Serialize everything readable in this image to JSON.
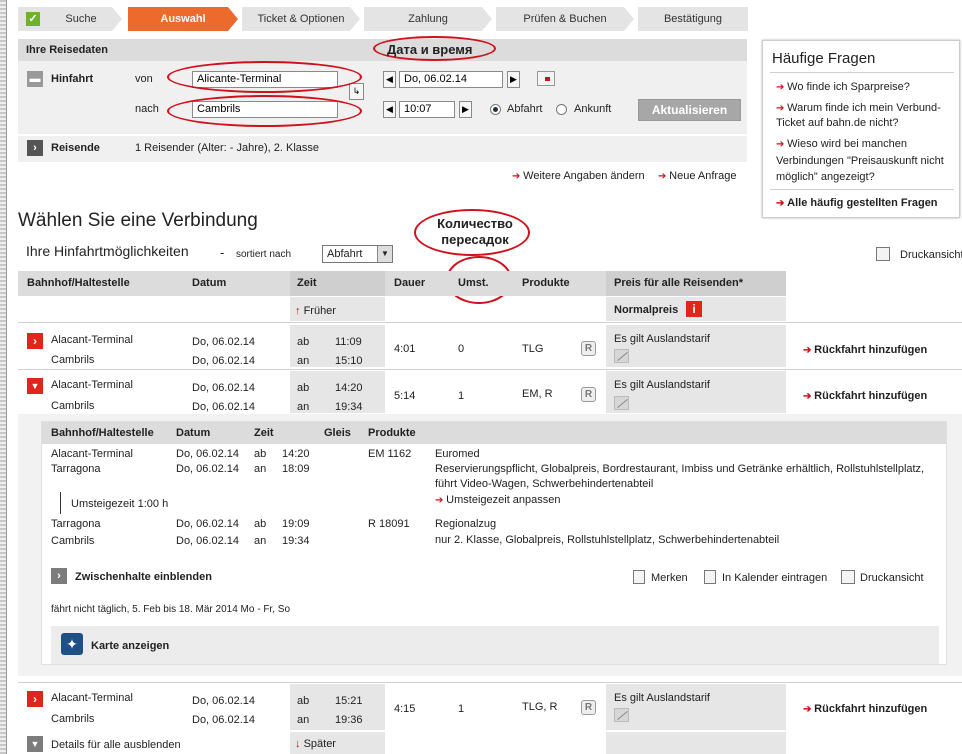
{
  "steps": [
    {
      "label": "Suche"
    },
    {
      "label": "Auswahl"
    },
    {
      "label": "Ticket & Optionen"
    },
    {
      "label": "Zahlung"
    },
    {
      "label": "Prüfen & Buchen"
    },
    {
      "label": "Bestätigung"
    }
  ],
  "reisedaten": {
    "title": "Ihre Reisedaten",
    "hinfahrt": "Hinfahrt",
    "von_label": "von",
    "von_value": "Alicante-Terminal",
    "nach_label": "nach",
    "nach_value": "Cambrils",
    "date_value": "Do, 06.02.14",
    "time_value": "10:07",
    "abfahrt": "Abfahrt",
    "ankunft": "Ankunft",
    "update_button": "Aktualisieren",
    "reisende_label": "Reisende",
    "reisende_value": "1 Reisender (Alter: - Jahre), 2. Klasse",
    "weitere": "Weitere Angaben ändern",
    "neue": "Neue Anfrage"
  },
  "annotations": {
    "date_time": "Дата и время",
    "transfers": "Количество пересадок"
  },
  "faq": {
    "title": "Häufige Fragen",
    "items": [
      "Wo finde ich Sparpreise?",
      "Warum finde ich mein Verbund-Ticket auf bahn.de nicht?",
      "Wieso wird bei manchen Verbindungen \"Preisauskunft nicht möglich\" angezeigt?"
    ],
    "all": "Alle häufig gestellten Fragen"
  },
  "results": {
    "title": "Wählen Sie eine Verbindung",
    "subtitle": "Ihre Hinfahrtmöglichkeiten",
    "dash": "-",
    "sorted": "sortiert nach",
    "sort_value": "Abfahrt",
    "print": "Druckansicht",
    "columns": [
      "Bahnhof/Haltestelle",
      "Datum",
      "Zeit",
      "Dauer",
      "Umst.",
      "Produkte",
      "Preis für alle Reisenden*"
    ],
    "earlier": "Früher",
    "later": "Später",
    "normalpreis": "Normalpreis",
    "rows": [
      {
        "from": "Alacant-Terminal",
        "to": "Cambrils",
        "date1": "Do, 06.02.14",
        "date2": "Do, 06.02.14",
        "ab": "ab",
        "an": "an",
        "t1": "11:09",
        "t2": "15:10",
        "dur": "4:01",
        "umst": "0",
        "prod": "TLG",
        "price": "Es gilt Auslandstarif",
        "ret": "Rückfahrt hinzufügen"
      },
      {
        "from": "Alacant-Terminal",
        "to": "Cambrils",
        "date1": "Do, 06.02.14",
        "date2": "Do, 06.02.14",
        "ab": "ab",
        "an": "an",
        "t1": "14:20",
        "t2": "19:34",
        "dur": "5:14",
        "umst": "1",
        "prod": "EM, R",
        "price": "Es gilt Auslandstarif",
        "ret": "Rückfahrt hinzufügen"
      },
      {
        "from": "Alacant-Terminal",
        "to": "Cambrils",
        "date1": "Do, 06.02.14",
        "date2": "Do, 06.02.14",
        "ab": "ab",
        "an": "an",
        "t1": "15:21",
        "t2": "19:36",
        "dur": "4:15",
        "umst": "1",
        "prod": "TLG, R",
        "price": "Es gilt Auslandstarif",
        "ret": "Rückfahrt hinzufügen"
      }
    ],
    "hide_details": "Details für alle ausblenden"
  },
  "details": {
    "columns": [
      "Bahnhof/Haltestelle",
      "Datum",
      "Zeit",
      "Gleis",
      "Produkte"
    ],
    "leg1": {
      "from": "Alacant-Terminal",
      "to": "Tarragona",
      "d1": "Do, 06.02.14",
      "d2": "Do, 06.02.14",
      "ab": "ab",
      "an": "an",
      "t1": "14:20",
      "t2": "18:09",
      "train": "EM 1162",
      "product": "Euromed",
      "info": "Reservierungspflicht, Globalpreis, Bordrestaurant, Imbiss und Getränke erhältlich, Rollstuhlstellplatz,",
      "info2": "führt Video-Wagen, Schwerbehindertenabteil"
    },
    "umsteige": "Umsteigezeit 1:00 h",
    "umsteige_link": "Umsteigezeit anpassen",
    "leg2": {
      "from": "Tarragona",
      "to": "Cambrils",
      "d1": "Do, 06.02.14",
      "d2": "Do, 06.02.14",
      "ab": "ab",
      "an": "an",
      "t1": "19:09",
      "t2": "19:34",
      "train": "R 18091",
      "product": "Regionalzug",
      "info": "nur 2. Klasse, Globalpreis, Rollstuhlstellplatz, Schwerbehindertenabteil"
    },
    "zwischenhalte": "Zwischenhalte einblenden",
    "merken": "Merken",
    "kalender": "In Kalender eintragen",
    "druck": "Druckansicht",
    "note": "fährt nicht täglich, 5. Feb bis 18. Mär 2014 Mo - Fr, So",
    "karte": "Karte anzeigen"
  }
}
